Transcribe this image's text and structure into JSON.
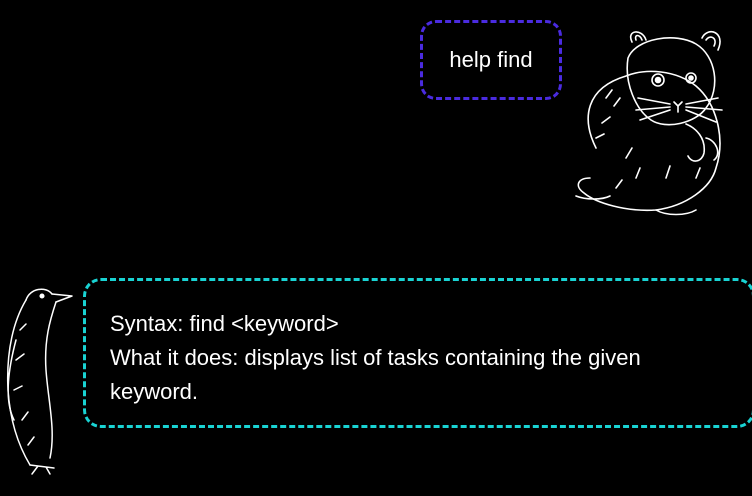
{
  "chat": {
    "user_message": "help find",
    "bot_response": {
      "line1": "Syntax: find <keyword>",
      "line2": "What it does: displays list of tasks containing the given keyword."
    }
  },
  "colors": {
    "background": "#000000",
    "user_bubble_border": "#4a2be0",
    "bot_bubble_border": "#19d3d3",
    "text": "#ffffff"
  },
  "icons": {
    "user_avatar": "hamster-avatar-icon",
    "bot_avatar": "penguin-avatar-icon"
  }
}
